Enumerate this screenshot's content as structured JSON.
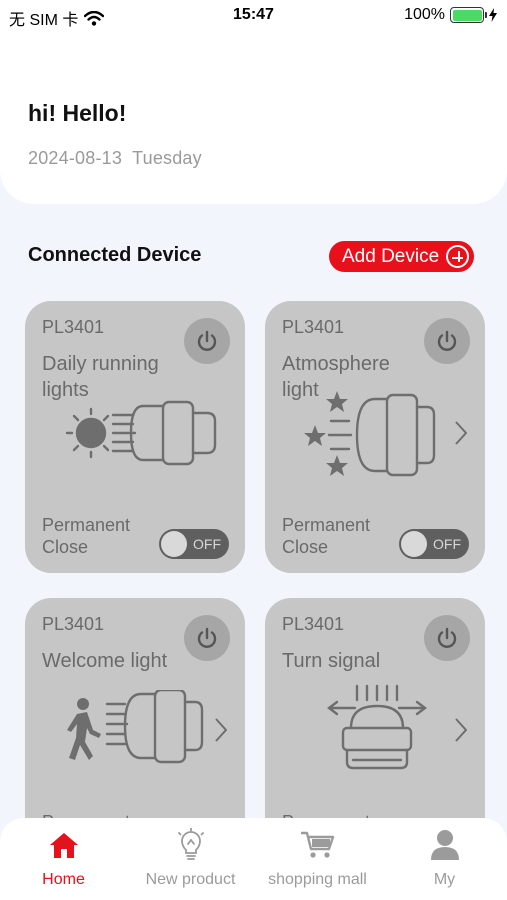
{
  "status_bar": {
    "carrier": "无 SIM 卡",
    "time": "15:47",
    "battery": "100%",
    "icons": [
      "wifi-icon",
      "battery-icon",
      "charging-bolt-icon"
    ]
  },
  "header": {
    "greeting": "hi! Hello!",
    "date": "2024-08-13",
    "weekday": "Tuesday"
  },
  "devices_section": {
    "title": "Connected Device",
    "add_button_label": "Add Device"
  },
  "devices": [
    {
      "model": "PL3401",
      "name": "Daily running lights",
      "mode": "Permanent",
      "state": "Close",
      "toggle": "OFF",
      "icon": "daylight-lamp-icon",
      "has_chevron": false
    },
    {
      "model": "PL3401",
      "name": "Atmosphere light",
      "mode": "Permanent",
      "state": "Close",
      "toggle": "OFF",
      "icon": "atmosphere-lamp-icon",
      "has_chevron": true
    },
    {
      "model": "PL3401",
      "name": "Welcome light",
      "mode": "Permanent",
      "state": "",
      "toggle": "",
      "icon": "welcome-walker-icon",
      "has_chevron": true
    },
    {
      "model": "PL3401",
      "name": "Turn signal",
      "mode": "Permanent",
      "state": "",
      "toggle": "",
      "icon": "turn-signal-icon",
      "has_chevron": true
    }
  ],
  "tabs": [
    {
      "label": "Home",
      "icon": "home-icon",
      "active": true
    },
    {
      "label": "New product",
      "icon": "lightbulb-icon",
      "active": false
    },
    {
      "label": "shopping mall",
      "icon": "cart-icon",
      "active": false
    },
    {
      "label": "My",
      "icon": "user-icon",
      "active": false
    }
  ],
  "colors": {
    "accent": "#e8101a",
    "card": "#c6c6c6",
    "background": "#f2f5fb"
  }
}
